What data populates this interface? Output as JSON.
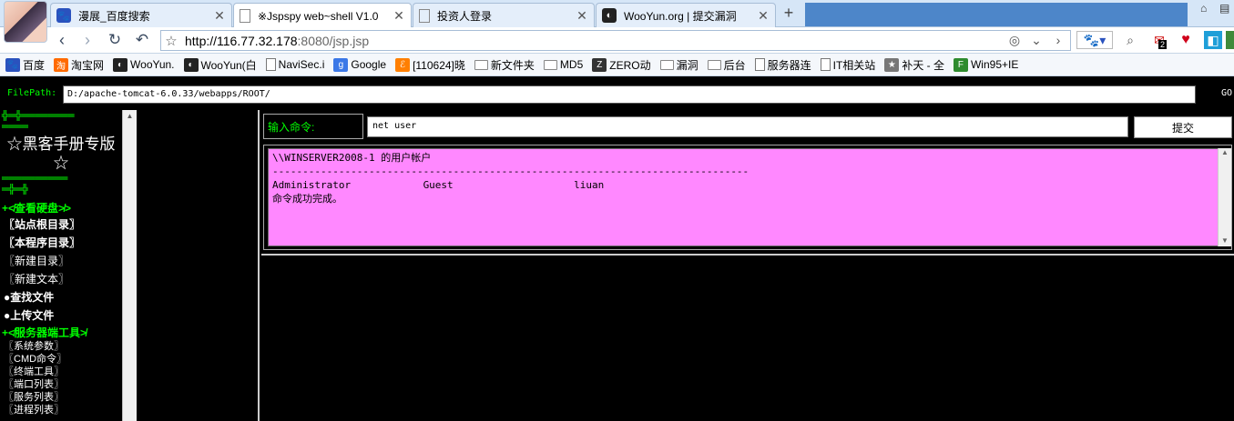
{
  "browser": {
    "tabs": [
      {
        "title": "漫展_百度搜索",
        "icon": "baidu-paw-icon"
      },
      {
        "title": "※Jspspy web~shell V1.0",
        "icon": "page-icon"
      },
      {
        "title": "投资人登录",
        "icon": "page-icon"
      },
      {
        "title": "WooYun.org | 提交漏洞",
        "icon": "wooyun-icon"
      }
    ],
    "url_host": "http://116.77.32.178",
    "url_rest": ":8080/jsp.jsp",
    "notification_count": "2",
    "bookmarks": [
      {
        "label": "百度",
        "icon": "baidu-paw-icon",
        "kind": "paw"
      },
      {
        "label": "淘宝网",
        "icon": "taobao-icon",
        "kind": "tao"
      },
      {
        "label": "WooYun.",
        "icon": "wooyun-icon",
        "kind": "woo"
      },
      {
        "label": "WooYun(白",
        "icon": "wooyun-icon",
        "kind": "woo"
      },
      {
        "label": "NaviSec.i",
        "icon": "page-icon",
        "kind": "page"
      },
      {
        "label": "Google",
        "icon": "google-icon",
        "kind": "google"
      },
      {
        "label": "[110624]晓",
        "icon": "feed-icon",
        "kind": "feed"
      },
      {
        "label": "新文件夹",
        "icon": "folder-icon",
        "kind": "folder"
      },
      {
        "label": "MD5",
        "icon": "folder-icon",
        "kind": "folder"
      },
      {
        "label": "ZERO动",
        "icon": "zero-icon",
        "kind": "zero"
      },
      {
        "label": "漏洞",
        "icon": "folder-icon",
        "kind": "folder"
      },
      {
        "label": "后台",
        "icon": "folder-icon",
        "kind": "folder"
      },
      {
        "label": "服务器连",
        "icon": "page-icon",
        "kind": "page"
      },
      {
        "label": "IT相关站",
        "icon": "page-icon",
        "kind": "page"
      },
      {
        "label": "补天 - 全",
        "icon": "star-shield-icon",
        "kind": "butian"
      },
      {
        "label": "Win95+IE",
        "icon": "f-icon",
        "kind": "f"
      }
    ]
  },
  "shell": {
    "filepath_label": "FilePath:",
    "filepath_value": "D:/apache-tomcat-6.0.33/webapps/ROOT/",
    "go_label": "GO",
    "sidebar": {
      "deco_top": "╬═╬════════",
      "deco_top2": "════",
      "title": "☆黑客手册专版☆",
      "deco_bottom": "══════════",
      "deco_bottom2": "═╬═╬",
      "disk_section": "+≮查看硬盘≯>",
      "items_bold": [
        "〖站点根目录〗",
        "〖本程序目录〗"
      ],
      "items_plain": [
        "〖新建目录〗",
        "〖新建文本〗"
      ],
      "items_dot": [
        "●查找文件",
        "●上传文件"
      ],
      "tools_section": "+≮服务器端工具≯",
      "tools": [
        "〖系统参数〗",
        "〖CMD命令〗",
        "〖终端工具〗",
        "〖端口列表〗",
        "〖服务列表〗",
        "〖进程列表〗"
      ]
    },
    "cmd_label": "输入命令:",
    "cmd_value": "net user",
    "submit_label": "提交",
    "output_lines": [
      "\\\\WINSERVER2008-1 的用户帐户",
      "",
      "-------------------------------------------------------------------------------",
      "Administrator            Guest                    liuan",
      "命令成功完成。"
    ]
  },
  "colors": {
    "output_bg": "#ff88ff",
    "accent_green": "#00ff00",
    "page_bg": "#000000"
  }
}
